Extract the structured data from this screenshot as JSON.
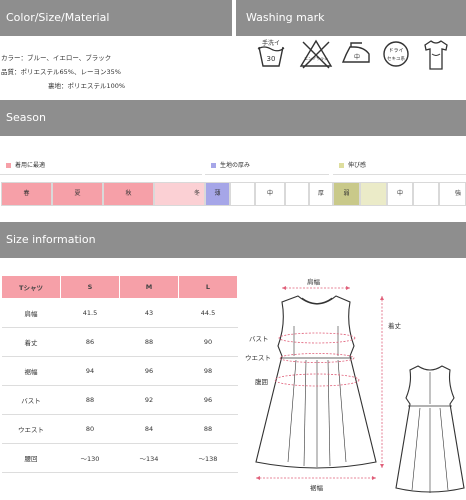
{
  "headers": {
    "material": "Color/Size/Material",
    "washing": "Washing mark",
    "season": "Season",
    "size": "Size information"
  },
  "material": {
    "line1": "カラー：ブルー、イエロー、ブラック",
    "line2": "品質：ポリエステル65%、レーヨン35%",
    "line3": "裏地：ポリエステル100%"
  },
  "washing_icons": [
    {
      "icon": "hand-wash-30-icon",
      "label_top": "手洗イ",
      "label": "30"
    },
    {
      "icon": "no-bleach-icon",
      "label": "エンソサラシ"
    },
    {
      "icon": "iron-low-icon",
      "label": "中"
    },
    {
      "icon": "dry-clean-icon",
      "label_top": "ドライ",
      "label": "セキユ系"
    },
    {
      "icon": "hang-dry-icon",
      "label": ""
    }
  ],
  "season": {
    "legend": [
      "着用に最適",
      "生地の厚み",
      "伸び感"
    ],
    "legend_colors": [
      "#f6a0a8",
      "#a6a6e8",
      "#dede9e"
    ],
    "seasons": [
      "春",
      "夏",
      "秋",
      "冬"
    ],
    "thickness": [
      "薄",
      "中",
      "厚"
    ],
    "stretch": [
      "弱",
      "中",
      "強"
    ]
  },
  "size_table": {
    "headers": [
      "Tシャツ",
      "S",
      "M",
      "L"
    ],
    "rows": [
      [
        "肩幅",
        "41.5",
        "43",
        "44.5"
      ],
      [
        "着丈",
        "86",
        "88",
        "90"
      ],
      [
        "裾幅",
        "94",
        "96",
        "98"
      ],
      [
        "バスト",
        "88",
        "92",
        "96"
      ],
      [
        "ウエスト",
        "80",
        "84",
        "88"
      ],
      [
        "腰回",
        "～130",
        "～134",
        "～138"
      ]
    ]
  },
  "diagram": {
    "shoulder": "肩幅",
    "length": "着丈",
    "bust": "バスト",
    "waist": "ウエスト",
    "hip": "腹囲",
    "hem": "裾幅"
  },
  "colors": {
    "header_bg": "#8e8e8e",
    "pink": "#f6a0a8",
    "light_pink": "#fbd0d4",
    "purple": "#a6a6e8",
    "yellow": "#dede9e",
    "measure": "#e0607a"
  }
}
